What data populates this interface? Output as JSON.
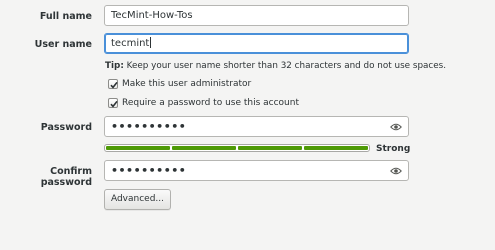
{
  "form": {
    "full_name": {
      "label": "Full name",
      "value": "TecMint-How-Tos"
    },
    "user_name": {
      "label": "User name",
      "value": "tecmint"
    },
    "tip": {
      "prefix": "Tip:",
      "text": " Keep your user name shorter than 32 characters and do not use spaces."
    },
    "admin_checkbox": {
      "label": "Make this user administrator",
      "checked": true
    },
    "require_password_checkbox": {
      "label": "Require a password to use this account",
      "checked": true
    },
    "password": {
      "label": "Password",
      "value": "••••••••••"
    },
    "strength": {
      "label": "Strong",
      "level": 1.0,
      "segments": 4,
      "color": "#4e9a06"
    },
    "confirm_password": {
      "label": "Confirm password",
      "value": "••••••••••"
    },
    "advanced_button": "Advanced..."
  },
  "icons": {
    "reveal": "eye-icon",
    "check": "checkmark-icon"
  },
  "colors": {
    "focus": "#4a90d9",
    "strength_bar": "#4e9a06"
  }
}
